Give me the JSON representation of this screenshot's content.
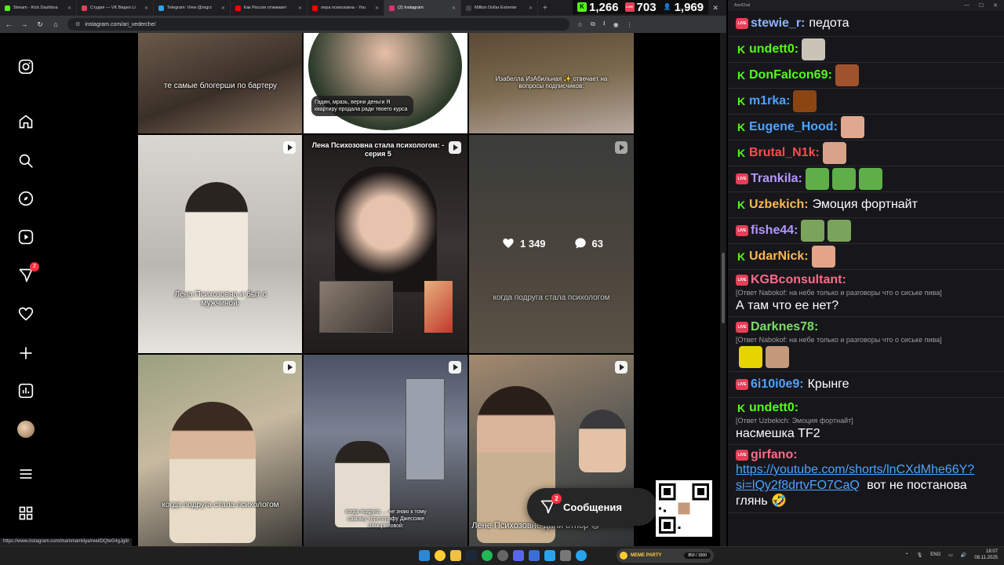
{
  "browser": {
    "tabs": [
      {
        "label": "Stream - Kick Dashboa",
        "color": "#53fc18",
        "active": false
      },
      {
        "label": "Студия — VK Видео Li",
        "color": "#e53f57",
        "active": false
      },
      {
        "label": "Telegram: View @mgrz",
        "color": "#2aa3ef",
        "active": false
      },
      {
        "label": "Как Россия отжимает",
        "color": "#ff0000",
        "active": false
      },
      {
        "label": "лера психозовна - You",
        "color": "#ff0000",
        "active": false
      },
      {
        "label": "(2) Instagram",
        "color": "#e1306c",
        "active": true
      },
      {
        "label": "Million Dollar Extreme",
        "color": "#444444",
        "active": false
      }
    ],
    "url": "instagram.com/ari_vederche/",
    "status_url": "https://www.instagram.com/mammamiiiya/reel/DQteG4gJg8/"
  },
  "viewer_counts": [
    {
      "platform": "kick",
      "value": "1,266",
      "color": "#53fc18"
    },
    {
      "platform": "vk",
      "value": "703",
      "color": "#e53f57"
    },
    {
      "platform": "people",
      "value": "1,969",
      "color": "#4ea3ff"
    }
  ],
  "instagram": {
    "sidebar_icons": [
      "instagram-logo-icon",
      "home-icon",
      "search-icon",
      "explore-icon",
      "reels-icon",
      "messages-icon",
      "notifications-icon",
      "create-icon",
      "dashboard-icon",
      "profile-avatar",
      "menu-icon",
      "also-from-meta-icon"
    ],
    "messages_badge": "2",
    "tiles": {
      "r0c0": "те самые блогерши по бартеру",
      "r0c1": "Гадин, мразь, верни деньги Я квартиру продала ради твоего курса",
      "r0c2": "Изабелла ИзАбильная ✨ отвечает на вопросы подписчиков:",
      "r1c0": "Лена Психозовна и быт с мужчиной:",
      "r1c1": "Лена Психозовна стала психологом: - серия 5",
      "r1c2": "когда подруга стала психологом",
      "r2c0": "когда подруга стала психологом",
      "r2c1": "когда подруга … не знаю к тому самому хореографу Джессике Заморийовой:",
      "r2c2": "Лене Психозовне дали отпор 😍"
    },
    "hover": {
      "likes": "1 349",
      "comments": "63"
    },
    "messages_label": "Сообщения"
  },
  "chat": {
    "title": "AxelChat",
    "messages": [
      {
        "platform": "vk",
        "user": "stewie_r:",
        "color": "#8ab4ff",
        "text": "педота"
      },
      {
        "platform": "kick",
        "user": "undett0:",
        "color": "#53fc18",
        "text": "",
        "emotes": [
          "#c9c3b8"
        ]
      },
      {
        "platform": "kick",
        "user": "DonFalcon69:",
        "color": "#53fc18",
        "text": "",
        "emotes": [
          "#a0522d"
        ]
      },
      {
        "platform": "kick",
        "user": "m1rka:",
        "color": "#4ea3ff",
        "text": "",
        "emotes": [
          "#8b4513"
        ]
      },
      {
        "platform": "kick",
        "user": "Eugene_Hood:",
        "color": "#4ea3ff",
        "text": "",
        "emotes": [
          "#e0a890"
        ]
      },
      {
        "platform": "kick",
        "user": "Brutal_N1k:",
        "color": "#ff4b4b",
        "text": "",
        "emotes": [
          "#d9a28a"
        ]
      },
      {
        "platform": "vk",
        "user": "Trankila:",
        "color": "#b497ff",
        "text": "",
        "emotes": [
          "#5fae4a",
          "#5fae4a",
          "#5fae4a"
        ]
      },
      {
        "platform": "kick",
        "user": "Uzbekich:",
        "color": "#ffb84d",
        "text": "Эмоция фортнайт"
      },
      {
        "platform": "vk",
        "user": "fishe44:",
        "color": "#b497ff",
        "text": "",
        "emotes": [
          "#7aa35c",
          "#7aa35c"
        ]
      },
      {
        "platform": "kick",
        "user": "UdarNick:",
        "color": "#ffb84d",
        "text": "",
        "emotes": [
          "#e3a48a"
        ]
      },
      {
        "platform": "vk",
        "user": "KGBconsultant:",
        "color": "#ff6b8a",
        "reply": "[Ответ Nabokof: на небе только и разговоры что о сиське пива]",
        "text": "А там что ее нет?"
      },
      {
        "platform": "vk",
        "user": "Darknes78:",
        "color": "#7ddc6a",
        "reply": "[Ответ Nabokof: на небе только и разговоры что о сиське пива]",
        "text": "",
        "emotes": [
          "#e6d400",
          "#c49a7a"
        ]
      },
      {
        "platform": "vk",
        "user": "6i10i0e9:",
        "color": "#4ea3ff",
        "text": "Крынге"
      },
      {
        "platform": "kick",
        "user": "undett0:",
        "color": "#53fc18",
        "reply": "[Ответ Uzbekich: Эмоция фортнайт]",
        "text": "насмешка TF2"
      },
      {
        "platform": "vk",
        "user": "girfano:",
        "color": "#ff6b8a",
        "link": "https://youtube.com/shorts/lnCXdMhe66Y?si=lQy2f8drtvFO7CaQ",
        "text": "вот не постанова глянь 🤣"
      }
    ]
  },
  "taskbar": {
    "meme_label": "MEME PARTY",
    "meme_progress": "850 / 1500",
    "lang": "ENG",
    "time": "18:07",
    "date": "08.11.2025"
  }
}
